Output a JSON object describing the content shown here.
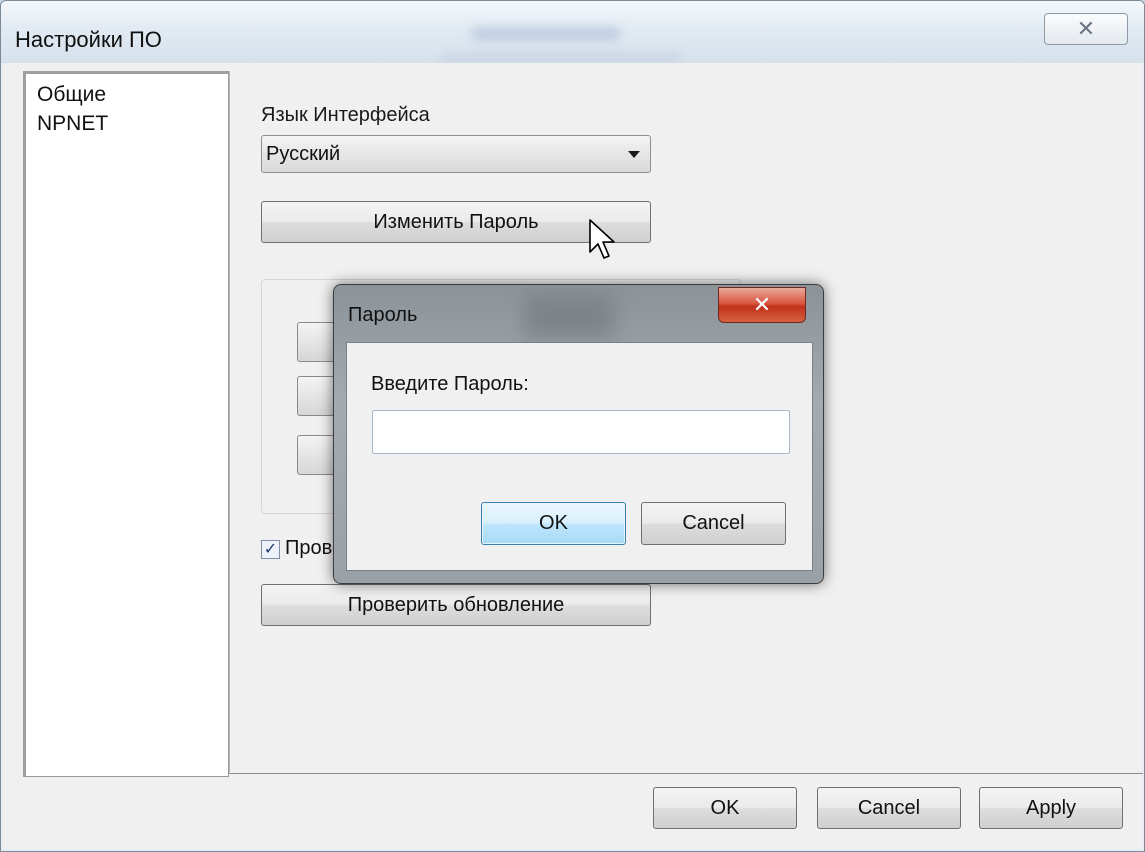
{
  "window": {
    "title": "Настройки ПО",
    "close_glyph": "✕"
  },
  "sidebar": {
    "items": [
      {
        "label": "Общие"
      },
      {
        "label": "NPNET"
      }
    ]
  },
  "general": {
    "language_label": "Язык Интерфейса",
    "language_value": "Русский",
    "change_password_label": "Изменить Пароль",
    "auto_update_check_label": "Прове",
    "auto_update_checked": true,
    "check_update_label": "Проверить обновление"
  },
  "footer": {
    "ok_label": "OK",
    "cancel_label": "Cancel",
    "apply_label": "Apply"
  },
  "password_dialog": {
    "title": "Пароль",
    "close_glyph": "✕",
    "prompt_label": "Введите Пароль:",
    "password_value": "",
    "ok_label": "OK",
    "cancel_label": "Cancel"
  },
  "icons": {
    "dropdown": "chevron-down-icon",
    "checkbox_mark": "check-icon",
    "cursor": "mouse-cursor-icon"
  },
  "colors": {
    "dialog_close_red": "#c0311c",
    "default_button_blue": "#a7d9f5",
    "window_background": "#f0f0f0"
  }
}
